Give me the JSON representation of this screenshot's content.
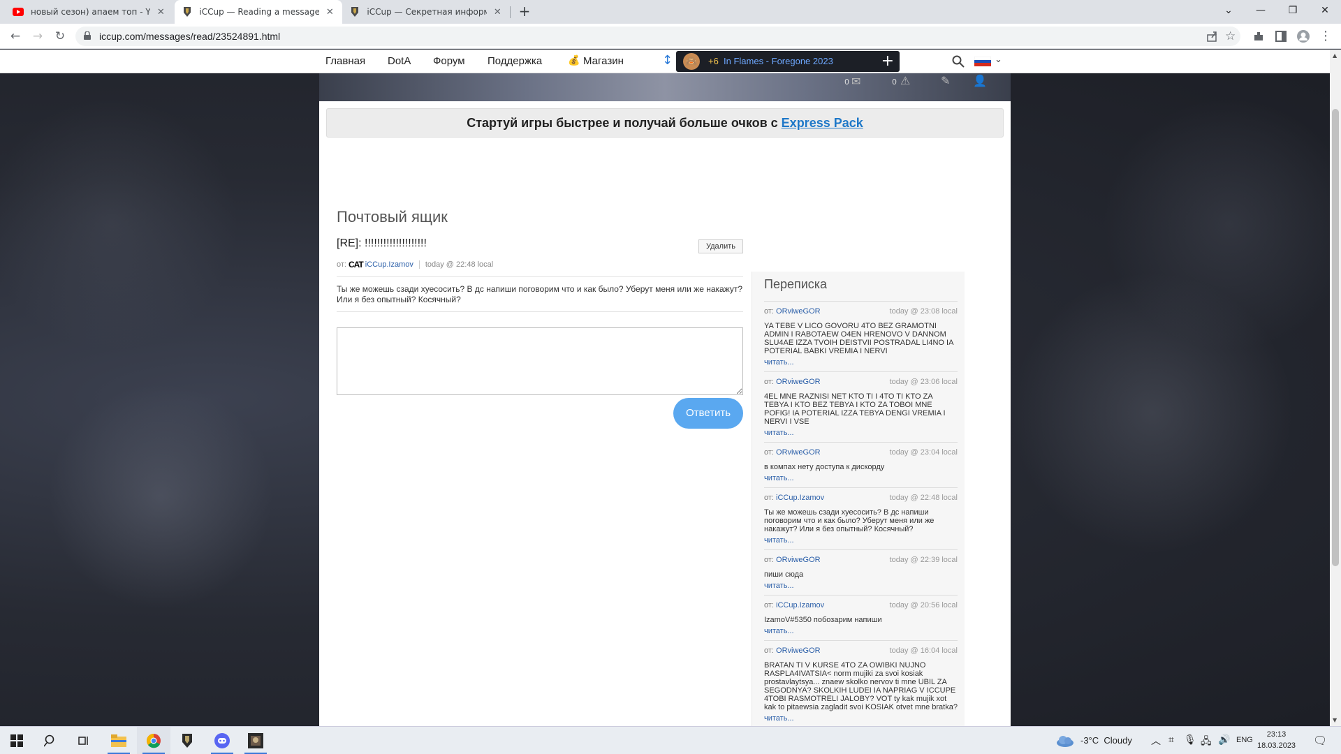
{
  "browser": {
    "tabs": [
      {
        "title": "новый сезон) апаем топ - YouTube",
        "icon": "youtube-icon"
      },
      {
        "title": "iCCup — Reading a message from",
        "icon": "iccup-icon"
      },
      {
        "title": "iCCup — Секретная информация",
        "icon": "iccup-icon"
      }
    ],
    "new_tab": "+",
    "url": "iccup.com/messages/read/23524891.html"
  },
  "site_nav": {
    "items": [
      "Главная",
      "DotA",
      "Форум",
      "Поддержка",
      "Магазин"
    ],
    "now_playing_badge": "+6",
    "now_playing": "In Flames - Foregone 2023",
    "counters": [
      "0",
      "0"
    ]
  },
  "express": {
    "text": "Стартуй игры быстрее и получай больше очков с ",
    "link": "Express Pack"
  },
  "mailbox": {
    "title": "Почтовый ящик",
    "subject": "[RE]: !!!!!!!!!!!!!!!!!!!!",
    "delete_label": "Удалить",
    "from_label": "от:",
    "cat_badge": "CAT",
    "author": "iCCup.Izamov",
    "time": "today @ 22:48 local",
    "body": "Ты же можешь сзади хуесосить? В дс напиши поговорим что и как было? Уберут меня или же накажут? Или я без опытный? Косячный?",
    "reply_label": "Ответить"
  },
  "thread": {
    "title": "Переписка",
    "from_label": "от:",
    "read_label": "читать...",
    "items": [
      {
        "author": "ORviweGOR",
        "time": "today @ 23:08 local",
        "body": "YA TEBE V LICO GOVORU 4TO BEZ GRAMOTNI ADMIN I RABOTAEW O4EN HRENOVO V DANNOM SLU4AE IZZA TVOIH DEISTVII POSTRADAL LI4NO IA POTERIAL BABKI VREMIA I NERVI"
      },
      {
        "author": "ORviweGOR",
        "time": "today @ 23:06 local",
        "body": "4EL MNE RAZNISI NET KTO TI I 4TO TI KTO ZA TEBYA I KTO BEZ TEBYA I KTO ZA TOBOI MNE POFIG! IA POTERIAL IZZA TEBYA DENGI VREMIA I NERVI I VSE"
      },
      {
        "author": "ORviweGOR",
        "time": "today @ 23:04 local",
        "body": "в компах нету доступа к дискорду"
      },
      {
        "author": "iCCup.Izamov",
        "time": "today @ 22:48 local",
        "body": "Ты же можешь сзади хуесосить? В дс напиши поговорим что и как было? Уберут меня или же накажут? Или я без опытный? Косячный?"
      },
      {
        "author": "ORviweGOR",
        "time": "today @ 22:39 local",
        "body": "пиши сюда"
      },
      {
        "author": "iCCup.Izamov",
        "time": "today @ 20:56 local",
        "body": "IzamoV#5350 побозарим напиши"
      },
      {
        "author": "ORviweGOR",
        "time": "today @ 16:04 local",
        "body": "BRATAN TI V KURSE 4TO ZA OWIBKI NUJNO RASPLA4IVATSIA< norm mujiki za svoi kosiak prostavlaytsya... znaew skolko nervov ti mne UBIL ZA SEGODNYA? SKOLKIH LUDEI IA NAPRIAG V ICCUPE 4TOBI RASMOTRELI JALOBY? VOT ty kak mujik xot kak to pitaewsia zagladit svoi KOSIAK otvet mne bratka?"
      }
    ]
  },
  "taskbar": {
    "weather": "-3°C  Cloudy",
    "lang": "ENG",
    "time": "23:13",
    "date": "18.03.2023"
  },
  "colors": {
    "accent": "#5aa8f0",
    "link": "#2a5ea8",
    "express_link": "#1e78c8"
  }
}
